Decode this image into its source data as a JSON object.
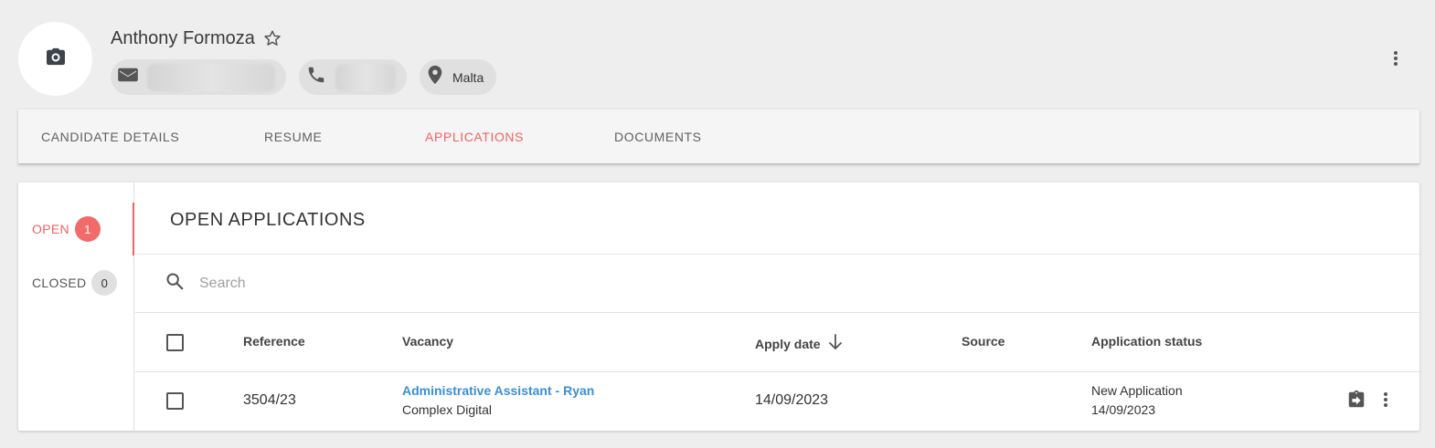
{
  "profile": {
    "name": "Anthony Formoza",
    "location": "Malta"
  },
  "tabs": [
    {
      "label": "CANDIDATE DETAILS"
    },
    {
      "label": "RESUME"
    },
    {
      "label": "APPLICATIONS"
    },
    {
      "label": "DOCUMENTS"
    }
  ],
  "nav": {
    "open_label": "OPEN",
    "open_count": "1",
    "closed_label": "CLOSED",
    "closed_count": "0"
  },
  "main": {
    "title": "OPEN APPLICATIONS",
    "search_placeholder": "Search"
  },
  "table": {
    "headers": {
      "reference": "Reference",
      "vacancy": "Vacancy",
      "apply_date": "Apply date",
      "source": "Source",
      "status": "Application status"
    },
    "rows": [
      {
        "reference": "3504/23",
        "vacancy_title": "Administrative Assistant - Ryan",
        "vacancy_company": "Complex Digital",
        "apply_date": "14/09/2023",
        "source": "",
        "status": "New Application",
        "status_date": "14/09/2023"
      }
    ]
  },
  "colors": {
    "accent": "#ef6461",
    "link": "#3a8fd6",
    "background": "#eeeeee"
  }
}
